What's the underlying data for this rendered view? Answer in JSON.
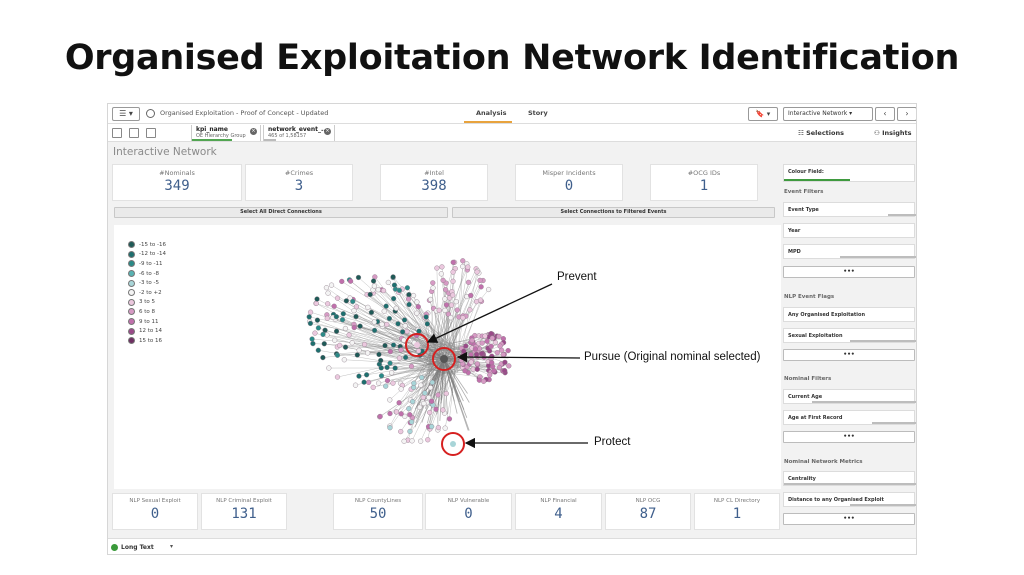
{
  "slide_title": "Organised Exploitation Network Identification",
  "topbar": {
    "menu_label": "☰ ▾",
    "app_title": "Organised Exploitation - Proof of Concept - Updated",
    "tab_analysis": "Analysis",
    "tab_story": "Story",
    "bookmark_label": "🔖 ▾",
    "sheet_selector": "Interactive Network ▾",
    "prev": "‹",
    "next": "›"
  },
  "selection_bar": {
    "chips": [
      {
        "name": "kpi_name",
        "value": "OE Hierarchy Group"
      },
      {
        "name": "network_event_...",
        "value": "465 of 1,58157"
      }
    ],
    "selections_label": "Selections",
    "insights_label": "Insights"
  },
  "sheet_title": "Interactive Network",
  "kpis": [
    {
      "label": "#Nominals",
      "value": "349"
    },
    {
      "label": "#Crimes",
      "value": "3"
    },
    {
      "label": "#Intel",
      "value": "398"
    },
    {
      "label": "Misper Incidents",
      "value": "0"
    },
    {
      "label": "#OCG IDs",
      "value": "1"
    }
  ],
  "buttons": {
    "select_direct": "Select All Direct Connections",
    "select_filtered": "Select Connections to Filtered Events"
  },
  "legend": [
    {
      "label": "-15 to -16",
      "color": "#1f5a57"
    },
    {
      "label": "-12 to -14",
      "color": "#1e6f6e"
    },
    {
      "label": "-9 to -11",
      "color": "#2a8a87"
    },
    {
      "label": "-6 to -8",
      "color": "#58b2b2"
    },
    {
      "label": "-3 to -5",
      "color": "#a8d5d8"
    },
    {
      "label": "-2 to +2",
      "color": "#f4f4f4"
    },
    {
      "label": "3 to 5",
      "color": "#ebc8de"
    },
    {
      "label": "6 to 8",
      "color": "#d69ac4"
    },
    {
      "label": "9 to 11",
      "color": "#c070ac"
    },
    {
      "label": "12 to 14",
      "color": "#9a4a89"
    },
    {
      "label": "15 to 16",
      "color": "#6e2f62"
    }
  ],
  "bottom_kpis": [
    {
      "label": "NLP Sexual Exploit",
      "value": "0"
    },
    {
      "label": "NLP Criminal Exploit",
      "value": "131"
    },
    {
      "label": "NLP CountyLines",
      "value": "50"
    },
    {
      "label": "NLP Vulnerable",
      "value": "0"
    },
    {
      "label": "NLP Financial",
      "value": "4"
    },
    {
      "label": "NLP OCG",
      "value": "87"
    },
    {
      "label": "NLP CL Directory",
      "value": "1"
    }
  ],
  "footer": {
    "label": "Long Text",
    "caret": "▾"
  },
  "filters": {
    "colour_field": "Colour Field:",
    "event_filters": "Event Filters",
    "event_type": "Event Type",
    "year": "Year",
    "mpd": "MPD",
    "nlp_event_flags": "NLP Event Flags",
    "any_oe": "Any Organised Exploitation",
    "sexual_exploitation": "Sexual Exploitation",
    "nominal_filters": "Nominal Filters",
    "current_age": "Current Age",
    "age_first_record": "Age at First Record",
    "nominal_network_metrics": "Nominal Network Metrics",
    "centrality": "Centrality",
    "distance_oe": "Distance to any Organised Exploit",
    "more": "•••"
  },
  "annotations": {
    "prevent": "Prevent",
    "pursue": "Pursue (Original nominal selected)",
    "protect": "Protect"
  }
}
